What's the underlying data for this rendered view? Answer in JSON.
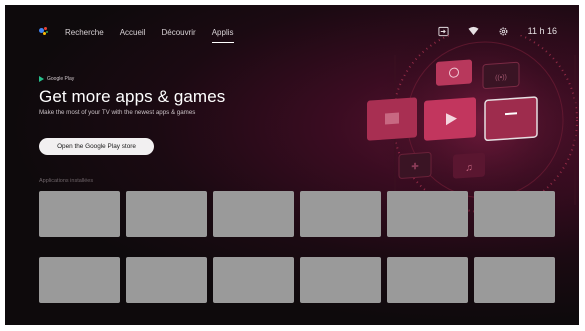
{
  "nav": {
    "search_label": "Recherche",
    "home_label": "Accueil",
    "discover_label": "Découvrir",
    "apps_label": "Applis"
  },
  "status": {
    "time": "11 h 16",
    "input_icon": "input-source-icon",
    "wifi_icon": "wifi-icon",
    "settings_icon": "gear-icon"
  },
  "hero": {
    "brand": "Google Play",
    "title": "Get more apps & games",
    "subtitle": "Make the most of your TV with the newest apps & games",
    "button_label": "Open the Google Play store"
  },
  "installed": {
    "section_label": "Applications installées",
    "tiles": [
      "",
      "",
      "",
      "",
      "",
      "",
      "",
      "",
      "",
      "",
      "",
      ""
    ]
  },
  "colors": {
    "background": "#0e0a0c",
    "accent": "#c2365e",
    "tile": "#9a9a9a",
    "play_green": "#27c08c"
  }
}
